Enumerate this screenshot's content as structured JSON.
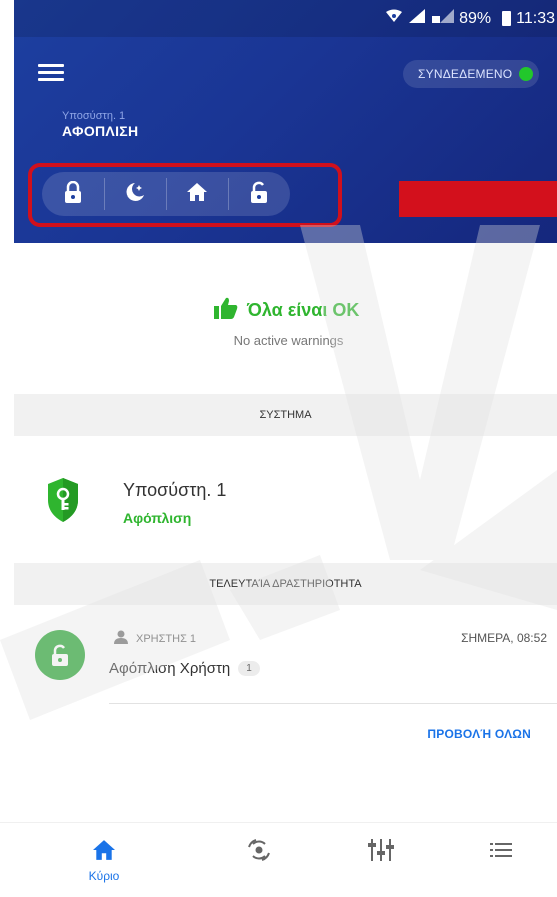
{
  "status_bar": {
    "battery": "89%",
    "time": "11:33"
  },
  "header": {
    "connection_label": "ΣΥΝΔΕΔΕΜΕΝΟ",
    "partition_label": "Υποσύστη. 1",
    "partition_state": "ΑΦΟΠΛΙΣΗ",
    "mode_buttons": [
      {
        "icon": "lock-icon"
      },
      {
        "icon": "moon-stars-icon"
      },
      {
        "icon": "home-icon"
      },
      {
        "icon": "unlock-icon"
      }
    ]
  },
  "status": {
    "title": "Όλα είναι ΟΚ",
    "subtitle": "No active warnings"
  },
  "system": {
    "section_title": "ΣΥΣΤΗΜΑ",
    "partition_name": "Υποσύστη. 1",
    "partition_state": "Αφόπλιση"
  },
  "activity": {
    "section_title": "ΤΕΛΕΥΤΑΊΑ ΔΡΑΣΤΗΡΙΟΤΗΤΑ",
    "user": "ΧΡΗΣΤΗΣ 1",
    "time": "ΣΗΜΕΡΑ, 08:52",
    "description": "Αφόπλιση Χρήστη",
    "badge": "1",
    "view_all": "ΠΡΟΒΟΛΉ ΟΛΩΝ"
  },
  "bottom_nav": {
    "home_label": "Κύριο"
  },
  "colors": {
    "header": "#1a3594",
    "accent_green": "#2fb52f",
    "link_blue": "#1a73e8",
    "alert_red": "#d3101c"
  }
}
